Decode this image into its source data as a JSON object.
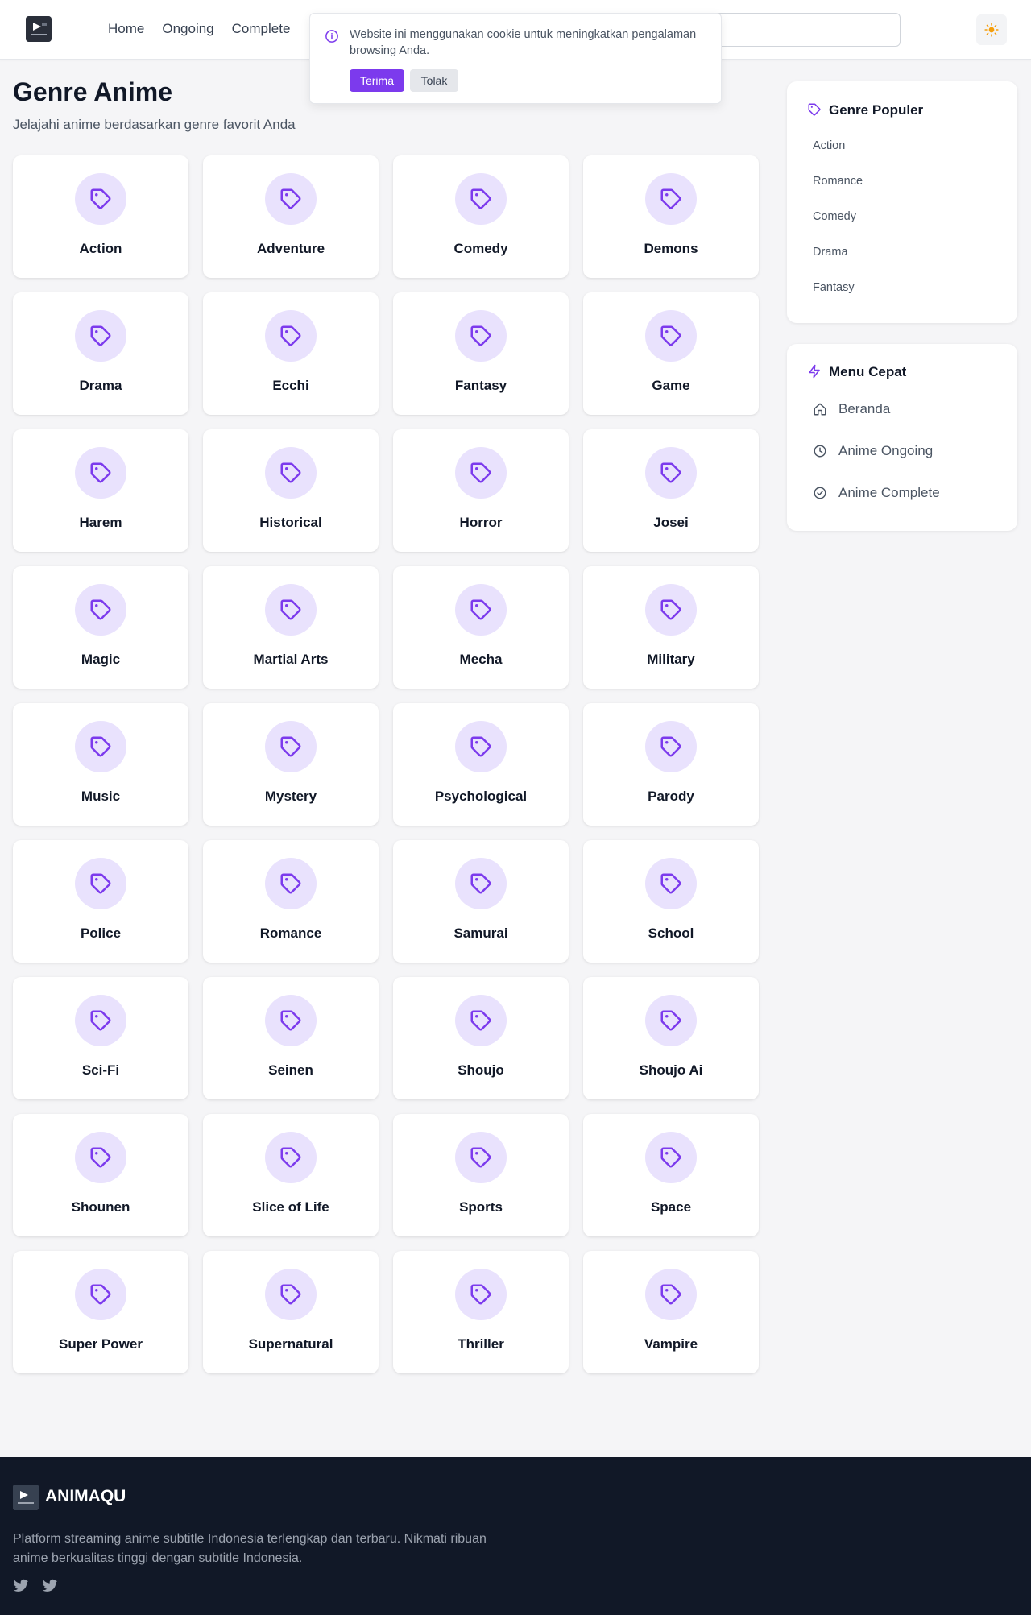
{
  "header": {
    "nav": [
      {
        "label": "Home"
      },
      {
        "label": "Ongoing"
      },
      {
        "label": "Complete"
      }
    ],
    "search_placeholder": ""
  },
  "cookie": {
    "message": "Website ini menggunakan cookie untuk meningkatkan pengalaman browsing Anda.",
    "accept": "Terima",
    "decline": "Tolak"
  },
  "page": {
    "title": "Genre Anime",
    "subtitle": "Jelajahi anime berdasarkan genre favorit Anda"
  },
  "genres": [
    "Action",
    "Adventure",
    "Comedy",
    "Demons",
    "Drama",
    "Ecchi",
    "Fantasy",
    "Game",
    "Harem",
    "Historical",
    "Horror",
    "Josei",
    "Magic",
    "Martial Arts",
    "Mecha",
    "Military",
    "Music",
    "Mystery",
    "Psychological",
    "Parody",
    "Police",
    "Romance",
    "Samurai",
    "School",
    "Sci-Fi",
    "Seinen",
    "Shoujo",
    "Shoujo Ai",
    "Shounen",
    "Slice of Life",
    "Sports",
    "Space",
    "Super Power",
    "Supernatural",
    "Thriller",
    "Vampire"
  ],
  "sidebar": {
    "popular": {
      "title": "Genre Populer",
      "items": [
        "Action",
        "Romance",
        "Comedy",
        "Drama",
        "Fantasy"
      ]
    },
    "quick": {
      "title": "Menu Cepat",
      "items": [
        {
          "label": "Beranda",
          "icon": "home-icon"
        },
        {
          "label": "Anime Ongoing",
          "icon": "clock-icon"
        },
        {
          "label": "Anime Complete",
          "icon": "check-circle-icon"
        }
      ]
    }
  },
  "footer": {
    "brand": "ANIMAQU",
    "description": "Platform streaming anime subtitle Indonesia terlengkap dan terbaru. Nikmati ribuan anime berkualitas tinggi dengan subtitle Indonesia."
  },
  "colors": {
    "accent": "#7c3aed",
    "icon_bg": "#e9e2fd",
    "footer_bg": "#111827",
    "sun": "#f59e0b"
  }
}
